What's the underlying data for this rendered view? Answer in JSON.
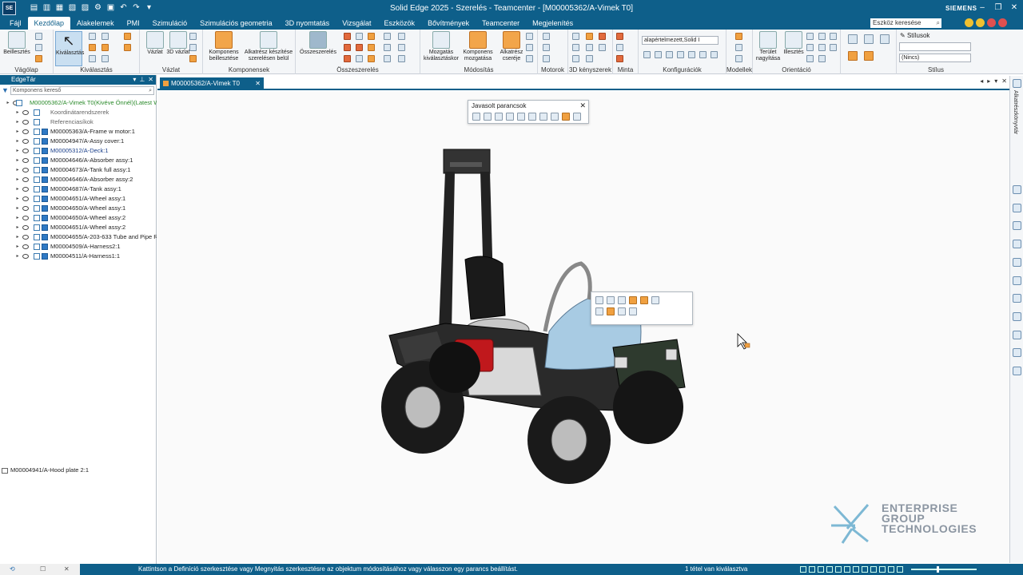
{
  "window": {
    "logo": "SE",
    "title": "Solid Edge 2025 - Szerelés - Teamcenter - [M00005362/A-Vimek T0]",
    "brand": "SIEMENS"
  },
  "menu": {
    "items": [
      "Fájl",
      "Kezdőlap",
      "Alakelemek",
      "PMI",
      "Szimuláció",
      "Szimulációs geometria",
      "3D nyomtatás",
      "Vizsgálat",
      "Eszközök",
      "Bővítmények",
      "Teamcenter",
      "Megjelenítés"
    ],
    "active_index": 1,
    "tool_search_placeholder": "Eszköz keresése"
  },
  "ribbon": {
    "groups": {
      "vagolap": "Vágólap",
      "kivalasztas": "Kiválasztás",
      "vazlat": "Vázlat",
      "komponensek": "Komponensek",
      "osszeszerelés": "Összeszerelés",
      "modositas": "Módosítás",
      "motorok": "Motorok",
      "kenyszerek": "3D kényszerek",
      "minta": "Minta",
      "konfiguraciok": "Konfigurációk",
      "modellek": "Modellek",
      "orientacio": "Orientáció",
      "stilus": "Stílus"
    },
    "buttons": {
      "beillesztes": "Beillesztés",
      "kivalasztas": "Kiválasztás",
      "vazlat": "Vázlat",
      "vazlat3d": "3D vázlat",
      "komponens_beillesztese": "Komponens beillesztése",
      "alkatresz_keszitese": "Alkatrész készítése szerelésen belül",
      "osszeszereles": "Összeszerelés",
      "mozgatas_kivalasztaskor": "Mozgatás kiválasztáskor",
      "komponens_mozgatasa": "Komponens mozgatása",
      "alkatresz_csereje": "Alkatrész cseréje",
      "terulet_nagyitasa": "Terület nagyítása",
      "illesztes": "Illesztés",
      "stilusok": "Stílusok"
    },
    "config_combo": "alapértelmezett,Solid I",
    "style_combo_value": "(Nincs)"
  },
  "edgebar": {
    "title": "EdgeTár",
    "search_placeholder": "Komponens kereső",
    "root": "M00005362/A-Vimek T0(Kivéve Önnél)(Latest Wo",
    "nodes": [
      "Koordinátarendszerek",
      "Referenciasíkok",
      "M00005363/A-Frame w motor:1",
      "M00004947/A-Assy cover:1",
      "M00005312/A-Deck:1",
      "M00004646/A-Absorber assy:1",
      "M00004673/A-Tank full assy:1",
      "M00004646/A-Absorber assy:2",
      "M00004687/A-Tank assy:1",
      "M00004651/A-Wheel assy:1",
      "M00004650/A-Wheel assy:1",
      "M00004650/A-Wheel assy:2",
      "M00004651/A-Wheel assy:2",
      "M00004655/A-203-633 Tube and Pipe Ru",
      "M00004509/A-Harness2:1",
      "M00004511/A-Harness1:1"
    ],
    "selected_item": "M00004941/A-Hood plate 2:1"
  },
  "document": {
    "tab": "M00005362/A-Vimek T0"
  },
  "popup": {
    "title": "Javasolt parancsok"
  },
  "rightbar": {
    "label": "Alkatrészkönyvtár"
  },
  "watermark": {
    "line1": "ENTERPRISE",
    "line2": "GROUP",
    "line3": "TECHNOLOGIES"
  },
  "status": {
    "message": "Kattintson a Definíció szerkesztése vagy Megnyitás szerkesztésre az objektum módosításához vagy válasszon egy parancs beállítást.",
    "selection_count": "1 tétel van kiválasztva"
  },
  "colors": {
    "chrome": "#0e5f8a",
    "hood_blue": "#a8cbe3",
    "gas_can_red": "#c0181c",
    "watermark": "#8c96a2"
  }
}
